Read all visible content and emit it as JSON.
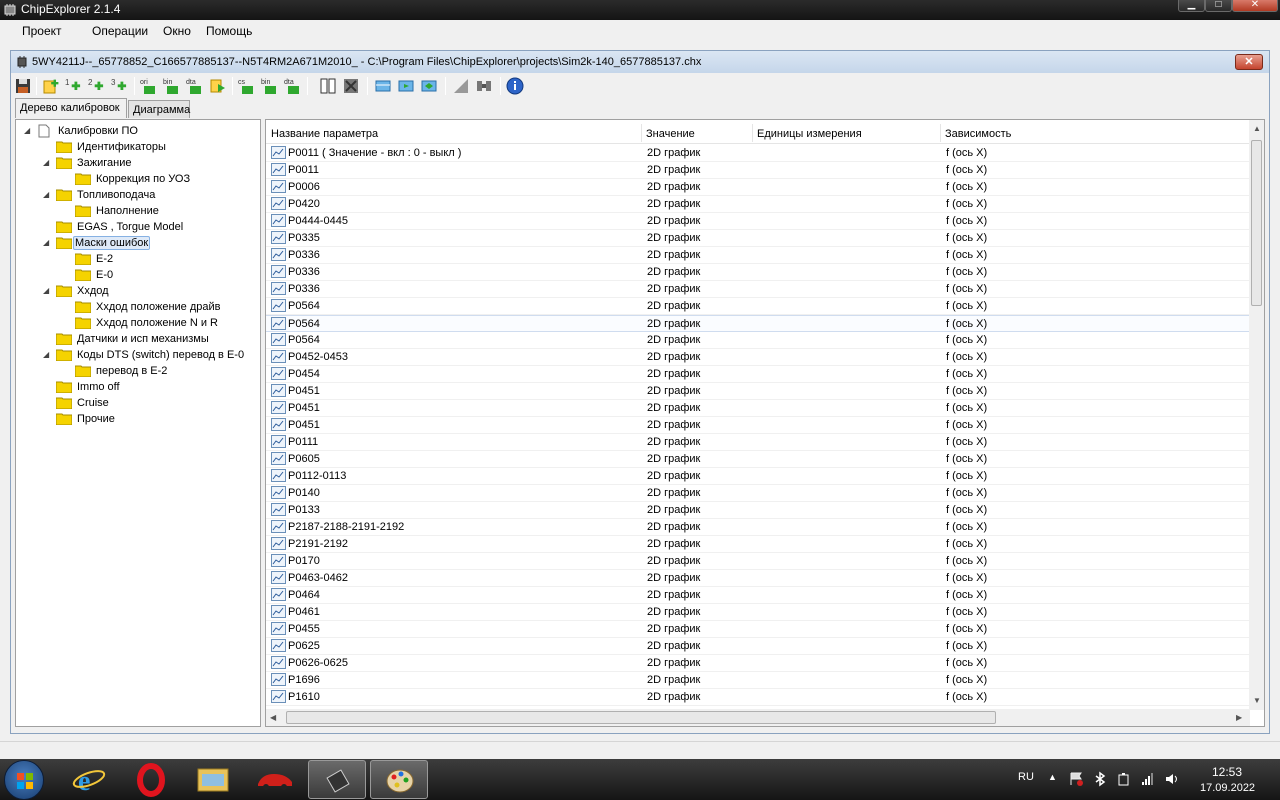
{
  "window": {
    "title": "ChipExplorer 2.1.4"
  },
  "menu": [
    "Проект",
    "Операции",
    "Окно",
    "Помощь"
  ],
  "child": {
    "title": "5WY4211J--_65778852_C166577885137--N5T4RM2A671M2010_ - C:\\Program Files\\ChipExplorer\\projects\\Sim2k-140_6577885137.chx"
  },
  "toolbar": {
    "buttons": [
      "save-icon",
      "add-item-icon",
      "add-one-d-icon",
      "add-two-d-icon",
      "add-three-d-icon",
      "ori-file-icon",
      "bin-file-icon",
      "dta-file-icon",
      "export-icon",
      "checksum-icon",
      "bin-export-icon",
      "dta-export-icon",
      "compare-icon",
      "delete-icon",
      "view-table-icon",
      "move-right-icon",
      "move-swap-icon",
      "graph-icon",
      "diff-icon",
      "info-icon"
    ],
    "labels": [
      "ori",
      "bin",
      "dta",
      "cs",
      "bin",
      "dta"
    ]
  },
  "tabs": [
    "Дерево калибровок",
    "Диаграмма"
  ],
  "tree": [
    {
      "label": "Калибровки ПО",
      "level": 0,
      "expanded": true,
      "type": "doc"
    },
    {
      "label": "Идентификаторы",
      "level": 1,
      "type": "folder"
    },
    {
      "label": "Зажигание",
      "level": 1,
      "expanded": true,
      "type": "folder"
    },
    {
      "label": "Коррекция по УОЗ",
      "level": 2,
      "type": "folder"
    },
    {
      "label": "Топливоподача",
      "level": 1,
      "expanded": true,
      "type": "folder"
    },
    {
      "label": "Наполнение",
      "level": 2,
      "type": "folder"
    },
    {
      "label": "EGAS , Torgue Model",
      "level": 1,
      "type": "folder"
    },
    {
      "label": "Маски ошибок",
      "level": 1,
      "expanded": true,
      "type": "folder",
      "selected": true
    },
    {
      "label": "E-2",
      "level": 2,
      "type": "folder"
    },
    {
      "label": "E-0",
      "level": 2,
      "type": "folder"
    },
    {
      "label": "Ххдод",
      "level": 1,
      "expanded": true,
      "type": "folder"
    },
    {
      "label": "Ххдод положение драйв",
      "level": 2,
      "type": "folder"
    },
    {
      "label": "Ххдод положение N и R",
      "level": 2,
      "type": "folder"
    },
    {
      "label": "Датчики и исп механизмы",
      "level": 1,
      "type": "folder"
    },
    {
      "label": "Коды DTS (switch) перевод в E-0",
      "level": 1,
      "expanded": true,
      "type": "folder"
    },
    {
      "label": "перевод в E-2",
      "level": 2,
      "type": "folder"
    },
    {
      "label": "Immo off",
      "level": 1,
      "type": "folder"
    },
    {
      "label": "Cruise",
      "level": 1,
      "type": "folder"
    },
    {
      "label": "Прочие",
      "level": 1,
      "type": "folder"
    }
  ],
  "grid": {
    "columns": [
      "Название параметра",
      "Значение",
      "Единицы измерения",
      "Зависимость"
    ],
    "rows": [
      [
        "P0011 ( Значение - вкл : 0 - выкл )",
        "2D график",
        "",
        "f (ось X)"
      ],
      [
        "P0011",
        "2D график",
        "",
        "f (ось X)"
      ],
      [
        "P0006",
        "2D график",
        "",
        "f (ось X)"
      ],
      [
        "P0420",
        "2D график",
        "",
        "f (ось X)"
      ],
      [
        "P0444-0445",
        "2D график",
        "",
        "f (ось X)"
      ],
      [
        "P0335",
        "2D график",
        "",
        "f (ось X)"
      ],
      [
        "P0336",
        "2D график",
        "",
        "f (ось X)"
      ],
      [
        "P0336",
        "2D график",
        "",
        "f (ось X)"
      ],
      [
        "P0336",
        "2D график",
        "",
        "f (ось X)"
      ],
      [
        "P0564",
        "2D график",
        "",
        "f (ось X)"
      ],
      [
        "P0564",
        "2D график",
        "",
        "f (ось X)"
      ],
      [
        "P0564",
        "2D график",
        "",
        "f (ось X)"
      ],
      [
        "P0452-0453",
        "2D график",
        "",
        "f (ось X)"
      ],
      [
        "P0454",
        "2D график",
        "",
        "f (ось X)"
      ],
      [
        "P0451",
        "2D график",
        "",
        "f (ось X)"
      ],
      [
        "P0451",
        "2D график",
        "",
        "f (ось X)"
      ],
      [
        "P0451",
        "2D график",
        "",
        "f (ось X)"
      ],
      [
        "P0111",
        "2D график",
        "",
        "f (ось X)"
      ],
      [
        "P0605",
        "2D график",
        "",
        "f (ось X)"
      ],
      [
        "P0112-0113",
        "2D график",
        "",
        "f (ось X)"
      ],
      [
        "P0140",
        "2D график",
        "",
        "f (ось X)"
      ],
      [
        "P0133",
        "2D график",
        "",
        "f (ось X)"
      ],
      [
        "P2187-2188-2191-2192",
        "2D график",
        "",
        "f (ось X)"
      ],
      [
        "P2191-2192",
        "2D график",
        "",
        "f (ось X)"
      ],
      [
        "P0170",
        "2D график",
        "",
        "f (ось X)"
      ],
      [
        "P0463-0462",
        "2D график",
        "",
        "f (ось X)"
      ],
      [
        "P0464",
        "2D график",
        "",
        "f (ось X)"
      ],
      [
        "P0461",
        "2D график",
        "",
        "f (ось X)"
      ],
      [
        "P0455",
        "2D график",
        "",
        "f (ось X)"
      ],
      [
        "P0625",
        "2D график",
        "",
        "f (ось X)"
      ],
      [
        "P0626-0625",
        "2D график",
        "",
        "f (ось X)"
      ],
      [
        "P1696",
        "2D график",
        "",
        "f (ось X)"
      ],
      [
        "P1610",
        "2D график",
        "",
        "f (ось X)"
      ]
    ],
    "selected_row": 10
  },
  "taskbar": {
    "apps": [
      "ie-icon",
      "opera-icon",
      "explorer-icon",
      "car-app-icon",
      "chip-explorer-icon",
      "paint-icon"
    ],
    "language": "RU",
    "time": "12:53",
    "date": "17.09.2022"
  }
}
